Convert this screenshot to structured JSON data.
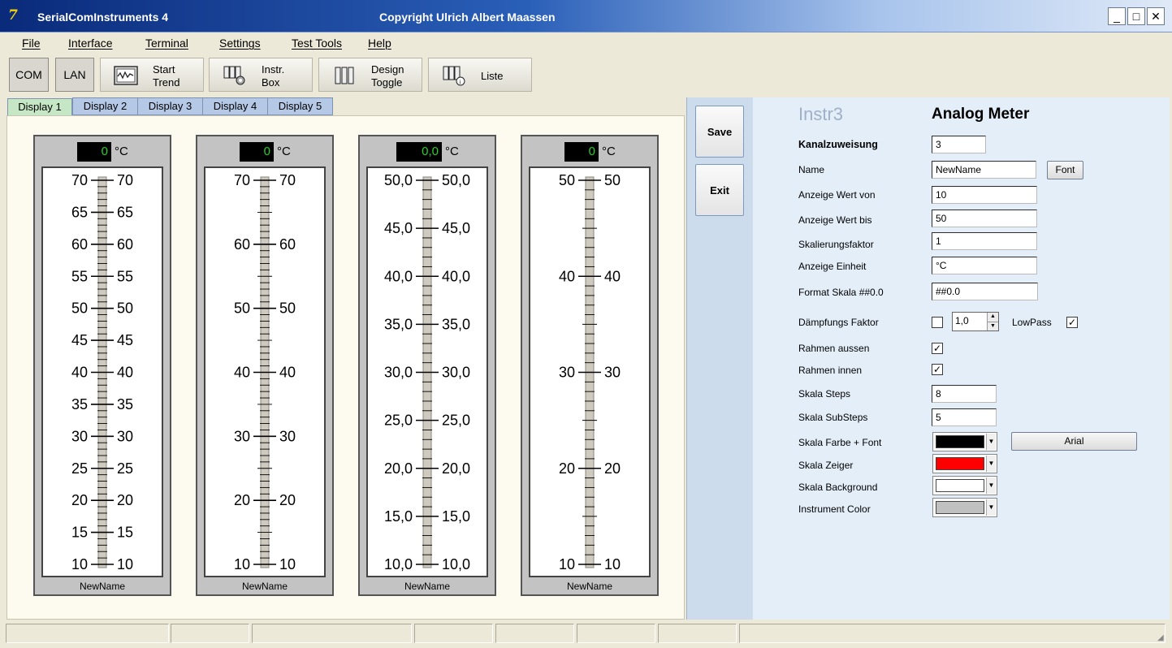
{
  "window": {
    "title": "SerialComInstruments  4",
    "copyright": "Copyright Ulrich Albert Maassen",
    "controls": {
      "min": "_",
      "max": "□",
      "close": "✕"
    }
  },
  "menu": [
    {
      "label": "File"
    },
    {
      "label": "Interface"
    },
    {
      "label": "Terminal"
    },
    {
      "label": "Settings"
    },
    {
      "label": "Test Tools"
    },
    {
      "label": "Help"
    }
  ],
  "toolbar": {
    "com": "COM",
    "lan": "LAN",
    "start_trend": [
      "Start",
      "Trend"
    ],
    "instr_box": [
      "Instr.",
      "Box"
    ],
    "design_toggle": [
      "Design",
      "Toggle"
    ],
    "liste": "Liste"
  },
  "tabs": [
    "Display 1",
    "Display 2",
    "Display 3",
    "Display 4",
    "Display 5"
  ],
  "meters": [
    {
      "value": "0",
      "unit": "°C",
      "name": "NewName",
      "min": 10,
      "max": 70,
      "labels": [
        70,
        65,
        60,
        55,
        50,
        45,
        40,
        35,
        30,
        25,
        20,
        15,
        10
      ],
      "fmt": "int"
    },
    {
      "value": "0",
      "unit": "°C",
      "name": "NewName",
      "min": 10,
      "max": 70,
      "labels": [
        70,
        60,
        50,
        40,
        30,
        20,
        10
      ],
      "fmt": "int"
    },
    {
      "value": "0,0",
      "unit": "°C",
      "name": "NewName",
      "min": 10,
      "max": 50,
      "labels": [
        "50,0",
        "45,0",
        "40,0",
        "35,0",
        "30,0",
        "25,0",
        "20,0",
        "15,0",
        "10,0"
      ],
      "fmt": "dec"
    },
    {
      "value": "0",
      "unit": "°C",
      "name": "NewName",
      "min": 10,
      "max": 50,
      "labels": [
        50,
        40,
        30,
        20,
        10
      ],
      "fmt": "int"
    }
  ],
  "side_buttons": {
    "save": "Save",
    "exit": "Exit"
  },
  "settings": {
    "instr_name": "Instr3",
    "instr_type": "Analog Meter",
    "kanal_label": "Kanalzuweisung",
    "kanal_value": "3",
    "name_label": "Name",
    "name_value": "NewName",
    "font_button": "Font",
    "wert_von_label": "Anzeige Wert von",
    "wert_von_value": "10",
    "wert_bis_label": "Anzeige Wert bis",
    "wert_bis_value": "50",
    "skal_label": "Skalierungsfaktor",
    "skal_value": "1",
    "einheit_label": "Anzeige Einheit",
    "einheit_value": "°C",
    "format_label": "Format Skala ##0.0",
    "format_value": "##0.0",
    "daempf_label": "Dämpfungs Faktor",
    "daempf_checked": false,
    "daempf_value": "1,0",
    "lowpass_label": "LowPass",
    "lowpass_checked": true,
    "rahmen_aussen_label": "Rahmen aussen",
    "rahmen_aussen_checked": true,
    "rahmen_innen_label": "Rahmen innen",
    "rahmen_innen_checked": true,
    "steps_label": "Skala Steps",
    "steps_value": "8",
    "substeps_label": "Skala SubSteps",
    "substeps_value": "5",
    "farbe_label": "Skala Farbe + Font",
    "farbe_color": "#000000",
    "font_name": "Arial",
    "zeiger_label": "Skala Zeiger",
    "zeiger_color": "#ff0000",
    "bg_label": "Skala Background",
    "bg_color": "#ffffff",
    "instr_color_label": "Instrument Color",
    "instr_color": "#c0c0c0"
  }
}
